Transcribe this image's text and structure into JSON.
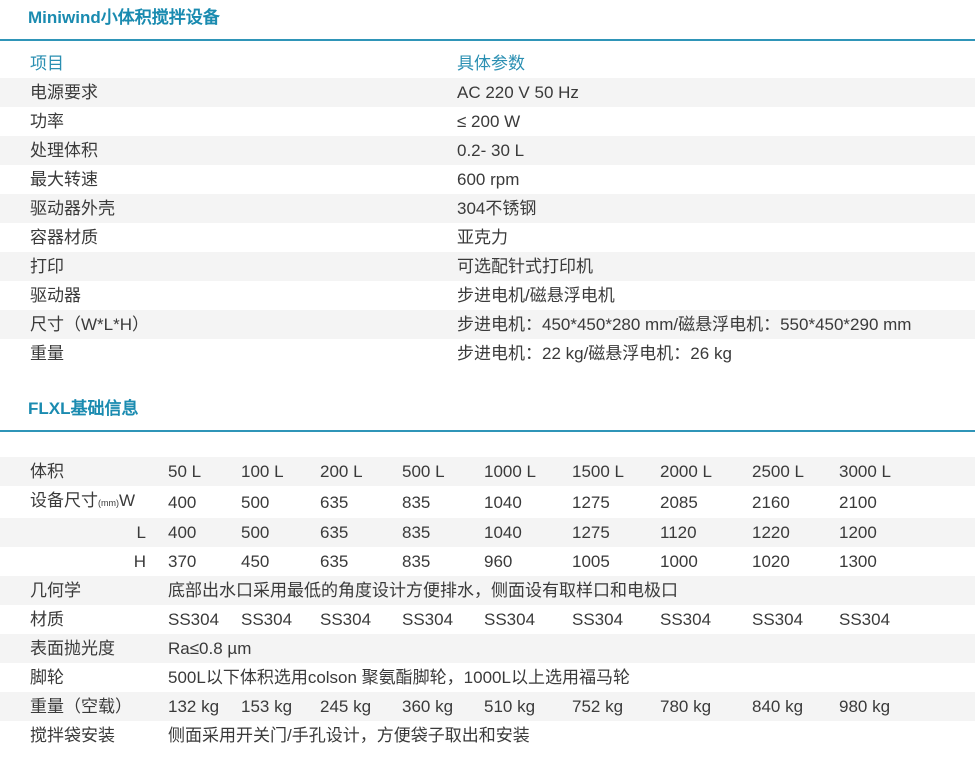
{
  "section1": {
    "title": "Miniwind小体积搅拌设备",
    "header": {
      "item": "项目",
      "value": "具体参数"
    },
    "rows": [
      {
        "item": "电源要求",
        "value": "AC 220  V 50 Hz"
      },
      {
        "item": "功率",
        "value": "≤ 200 W"
      },
      {
        "item": "处理体积",
        "value": "0.2- 30 L"
      },
      {
        "item": "最大转速",
        "value": "600  rpm"
      },
      {
        "item": "驱动器外壳",
        "value": "304不锈钢"
      },
      {
        "item": "容器材质",
        "value": "亚克力"
      },
      {
        "item": "打印",
        "value": "可选配针式打印机"
      },
      {
        "item": "驱动器",
        "value": "步进电机/磁悬浮电机"
      },
      {
        "item": "尺寸（W*L*H）",
        "value": "步进电机：450*450*280 mm/磁悬浮电机：550*450*290 mm"
      },
      {
        "item": "重量",
        "value": "步进电机：22 kg/磁悬浮电机：26 kg"
      }
    ]
  },
  "section2": {
    "title": "FLXL基础信息",
    "volume": {
      "label": "体积",
      "values": [
        "50 L",
        "100 L",
        "200 L",
        "500 L",
        "1000 L",
        "1500 L",
        "2000 L",
        "2500 L",
        "3000 L"
      ]
    },
    "dims": {
      "label": "设备尺寸",
      "unit": "(mm)",
      "rows": [
        {
          "sub": "W",
          "values": [
            "400",
            "500",
            "635",
            "835",
            "1040",
            "1275",
            "2085",
            "2160",
            "2100"
          ]
        },
        {
          "sub": "L",
          "values": [
            "400",
            "500",
            "635",
            "835",
            "1040",
            "1275",
            "1120",
            "1220",
            "1200"
          ]
        },
        {
          "sub": "H",
          "values": [
            "370",
            "450",
            "635",
            "835",
            "960",
            "1005",
            "1000",
            "1020",
            "1300"
          ]
        }
      ]
    },
    "geometry": {
      "label": "几何学",
      "text": "底部出水口采用最低的角度设计方便排水，侧面设有取样口和电极口"
    },
    "material": {
      "label": "材质",
      "values": [
        "SS304",
        "SS304",
        "SS304",
        "SS304",
        "SS304",
        "SS304",
        "SS304",
        "SS304",
        "SS304"
      ]
    },
    "polish": {
      "label": "表面抛光度",
      "text": "Ra≤0.8 µm"
    },
    "casters": {
      "label": "脚轮",
      "text": "500L以下体积选用colson 聚氨酯脚轮，1000L以上选用福马轮"
    },
    "weight": {
      "label": "重量（空载）",
      "values": [
        "132 kg",
        "153 kg",
        "245 kg",
        "360 kg",
        "510 kg",
        "752 kg",
        "780 kg",
        "840 kg",
        "980 kg"
      ]
    },
    "bag": {
      "label": "搅拌袋安装",
      "text": "侧面采用开关门/手孔设计，方便袋子取出和安装"
    }
  }
}
